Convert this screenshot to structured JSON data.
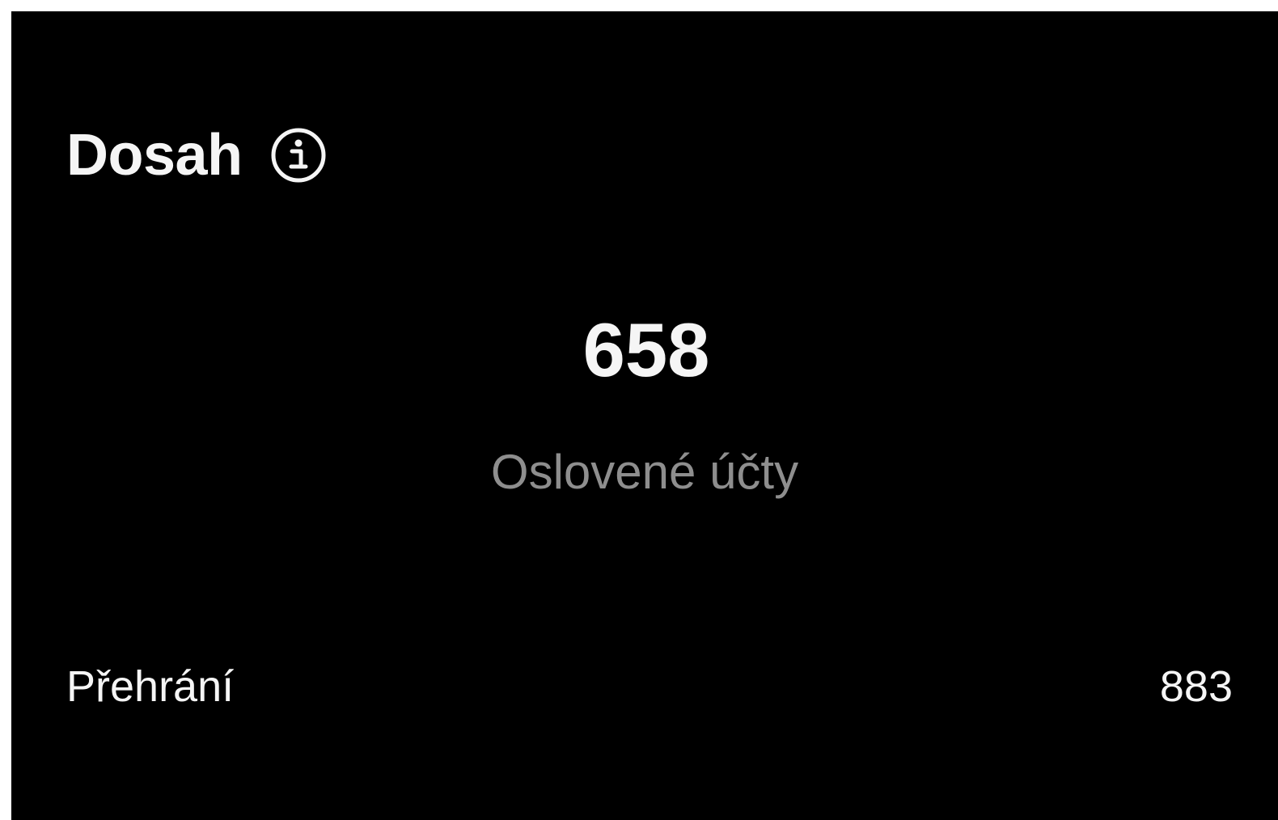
{
  "card": {
    "title": "Dosah",
    "info_icon": "info-circle-icon",
    "metric": {
      "value": "658",
      "label": "Oslovené účty"
    },
    "rows": [
      {
        "label": "Přehrání",
        "value": "883"
      }
    ]
  },
  "colors": {
    "background": "#000000",
    "text_primary": "#f5f5f5",
    "text_secondary": "#8e8e8e"
  }
}
